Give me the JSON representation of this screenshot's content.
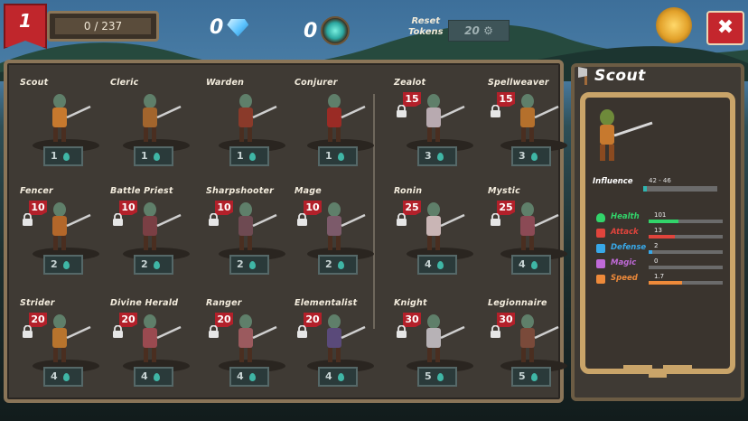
{
  "hud": {
    "level": "1",
    "xp": "0 / 237",
    "gems": "0",
    "crystals": "0",
    "reset_label_1": "Reset",
    "reset_label_2": "Tokens",
    "reset_tokens": "20"
  },
  "close_label": "✖",
  "heroes": [
    {
      "name": "Scout",
      "tier": "1",
      "locked": false,
      "unlock_level": "",
      "color": "#c7792e"
    },
    {
      "name": "Cleric",
      "tier": "1",
      "locked": false,
      "unlock_level": "",
      "color": "#a2652d"
    },
    {
      "name": "Warden",
      "tier": "1",
      "locked": false,
      "unlock_level": "",
      "color": "#8a3a2a"
    },
    {
      "name": "Conjurer",
      "tier": "1",
      "locked": false,
      "unlock_level": "",
      "color": "#9a2b25"
    },
    {
      "name": "Zealot",
      "tier": "3",
      "locked": true,
      "unlock_level": "15",
      "color": "#b8aab0"
    },
    {
      "name": "Spellweaver",
      "tier": "3",
      "locked": true,
      "unlock_level": "15",
      "color": "#b5702c"
    },
    {
      "name": "Fencer",
      "tier": "2",
      "locked": true,
      "unlock_level": "10",
      "color": "#b3672a"
    },
    {
      "name": "Battle Priest",
      "tier": "2",
      "locked": true,
      "unlock_level": "10",
      "color": "#7a3f44"
    },
    {
      "name": "Sharpshooter",
      "tier": "2",
      "locked": true,
      "unlock_level": "10",
      "color": "#6e4a52"
    },
    {
      "name": "Mage",
      "tier": "2",
      "locked": true,
      "unlock_level": "10",
      "color": "#7c5a6a"
    },
    {
      "name": "Ronin",
      "tier": "4",
      "locked": true,
      "unlock_level": "25",
      "color": "#c9b5b5"
    },
    {
      "name": "Mystic",
      "tier": "4",
      "locked": true,
      "unlock_level": "25",
      "color": "#8b4a55"
    },
    {
      "name": "Strider",
      "tier": "4",
      "locked": true,
      "unlock_level": "20",
      "color": "#b8742d"
    },
    {
      "name": "Divine Herald",
      "tier": "4",
      "locked": true,
      "unlock_level": "20",
      "color": "#9a4a50"
    },
    {
      "name": "Ranger",
      "tier": "4",
      "locked": true,
      "unlock_level": "20",
      "color": "#9b5a5e"
    },
    {
      "name": "Elementalist",
      "tier": "4",
      "locked": true,
      "unlock_level": "20",
      "color": "#5a4a7a"
    },
    {
      "name": "Knight",
      "tier": "5",
      "locked": true,
      "unlock_level": "30",
      "color": "#b7b2b6"
    },
    {
      "name": "Legionnaire",
      "tier": "5",
      "locked": true,
      "unlock_level": "30",
      "color": "#7a4a3a"
    }
  ],
  "detail": {
    "title": "Scout",
    "influence_label": "Influence",
    "influence_value": "42 - 46",
    "influence_fraction": 0.05,
    "stats": [
      {
        "name": "Health",
        "value": "101",
        "color": "#32d46a",
        "fraction": 0.4,
        "icon": "heart-icon"
      },
      {
        "name": "Attack",
        "value": "13",
        "color": "#e0443c",
        "fraction": 0.35,
        "icon": "sword-icon"
      },
      {
        "name": "Defense",
        "value": "2",
        "color": "#38a8e8",
        "fraction": 0.05,
        "icon": "shield-icon"
      },
      {
        "name": "Magic",
        "value": "0",
        "color": "#c06ad8",
        "fraction": 0.0,
        "icon": "magic-icon"
      },
      {
        "name": "Speed",
        "value": "1.7",
        "color": "#ee8a3a",
        "fraction": 0.45,
        "icon": "boot-icon"
      }
    ]
  }
}
